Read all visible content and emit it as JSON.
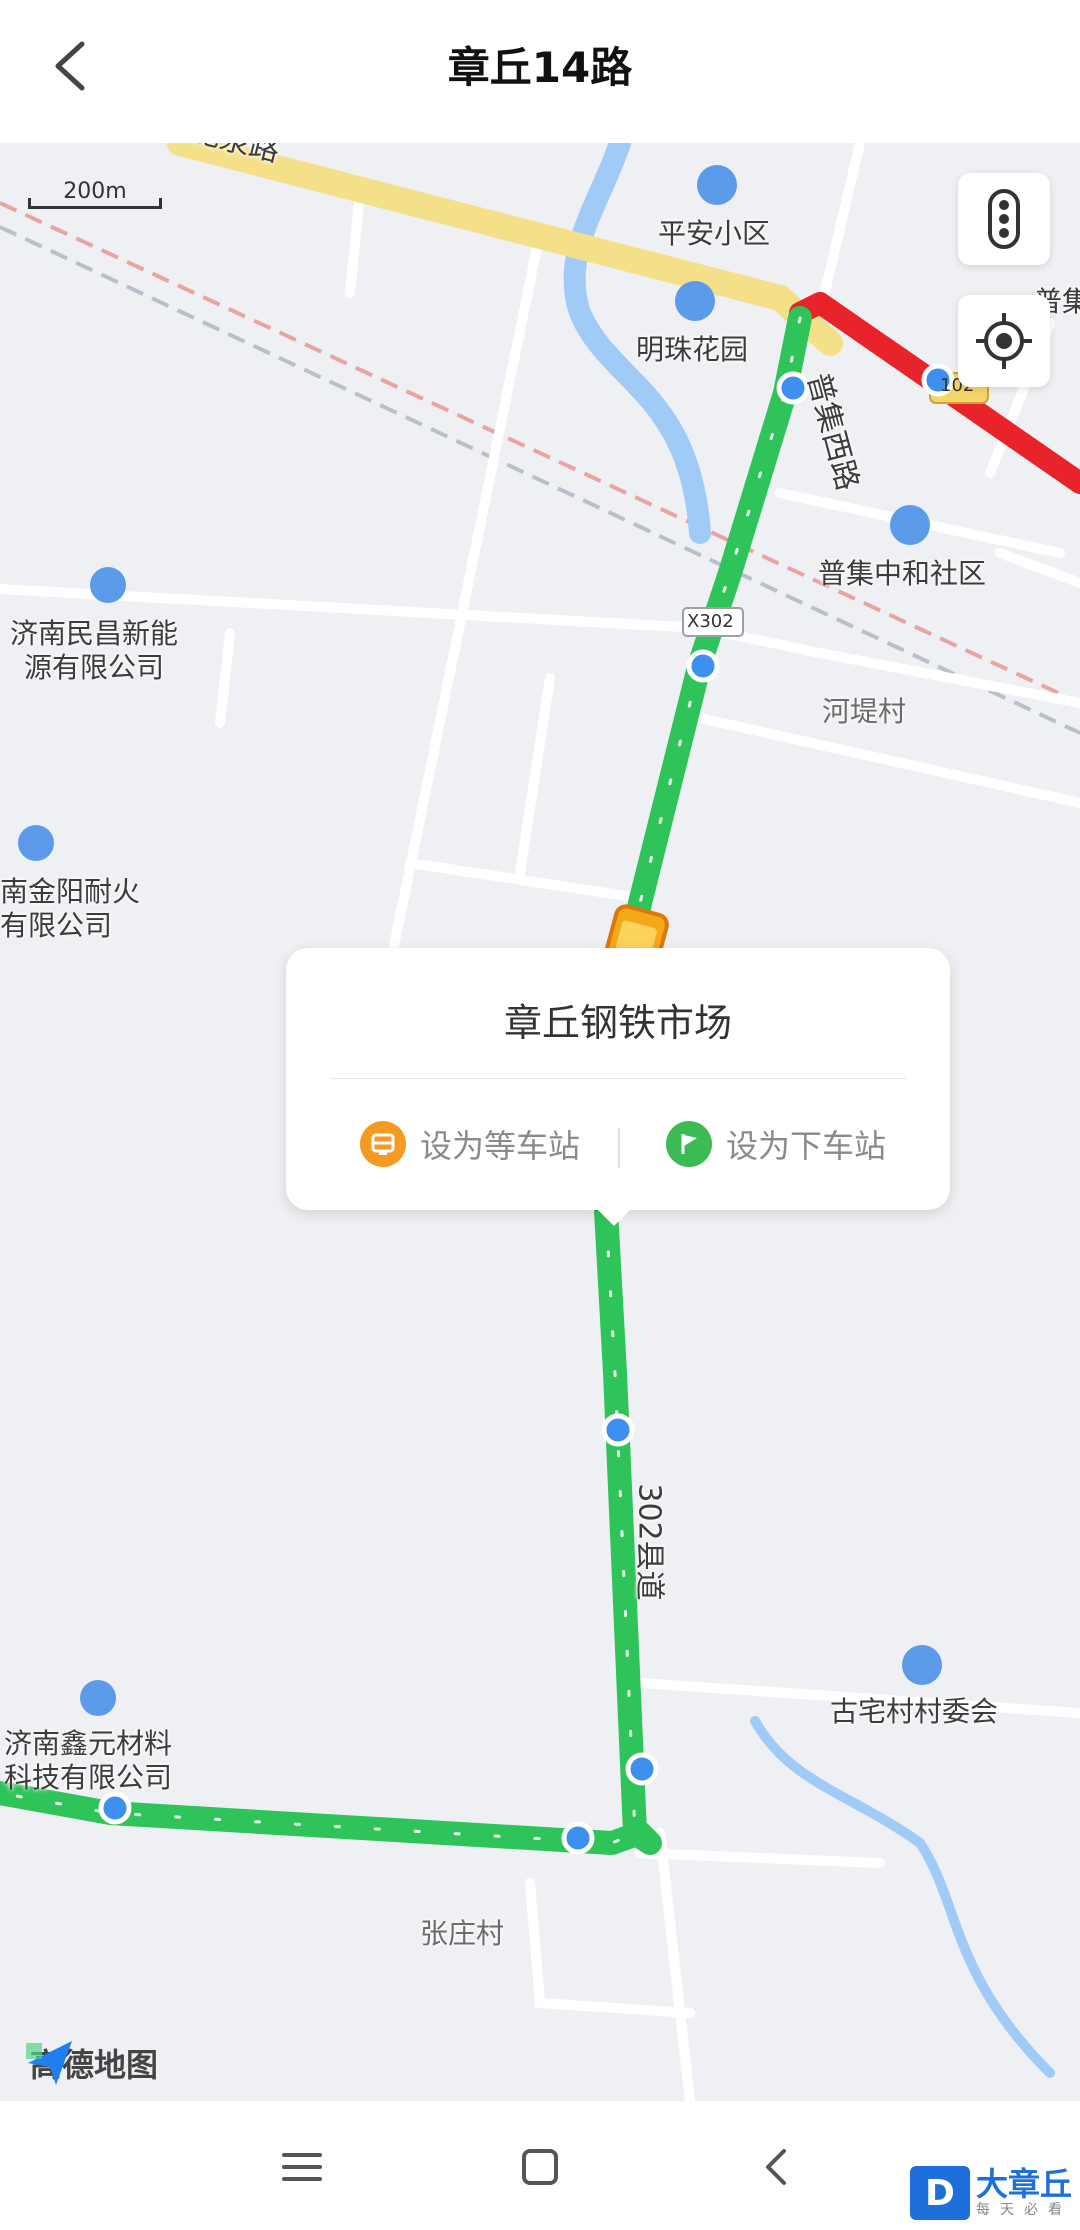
{
  "header": {
    "title": "章丘14路"
  },
  "map": {
    "scale_label": "200m",
    "road_labels": {
      "top_road": "龙泉路",
      "puji_west": "普集西路",
      "x302": "X302",
      "county_road": "302县道",
      "g102": "102",
      "puji_edge": "普集"
    },
    "pois": {
      "pingan": "平安小区",
      "mingzhu": "明珠花园",
      "puji_hehe": "普集中和社区",
      "minchang": "济南民昌新能\n源有限公司",
      "jinyang": "南金阳耐火\n有限公司",
      "xinyuan": "济南鑫元材料\n科技有限公司",
      "guzhai": "古宅村村委会"
    },
    "villages": {
      "hedi": "河堤村",
      "zhangzhuang": "张庄村"
    },
    "colors": {
      "route_green": "#2fc45a",
      "route_red": "#e8232a",
      "stop_blue": "#3d8ff0",
      "poi_blue": "#5b9bea",
      "water": "#9fcbf6"
    }
  },
  "popup": {
    "station": "章丘钢铁市场",
    "wait_label": "设为等车站",
    "alight_label": "设为下车站"
  },
  "provider": {
    "logo_text": "高德地图"
  },
  "watermark": {
    "brand": "大章丘",
    "sub": "每天必看"
  },
  "icons": {
    "back": "chevron-left-icon",
    "traffic": "traffic-light-icon",
    "locate": "locate-icon",
    "menu": "menu-icon",
    "home": "home-icon",
    "nav_back": "back-icon"
  }
}
